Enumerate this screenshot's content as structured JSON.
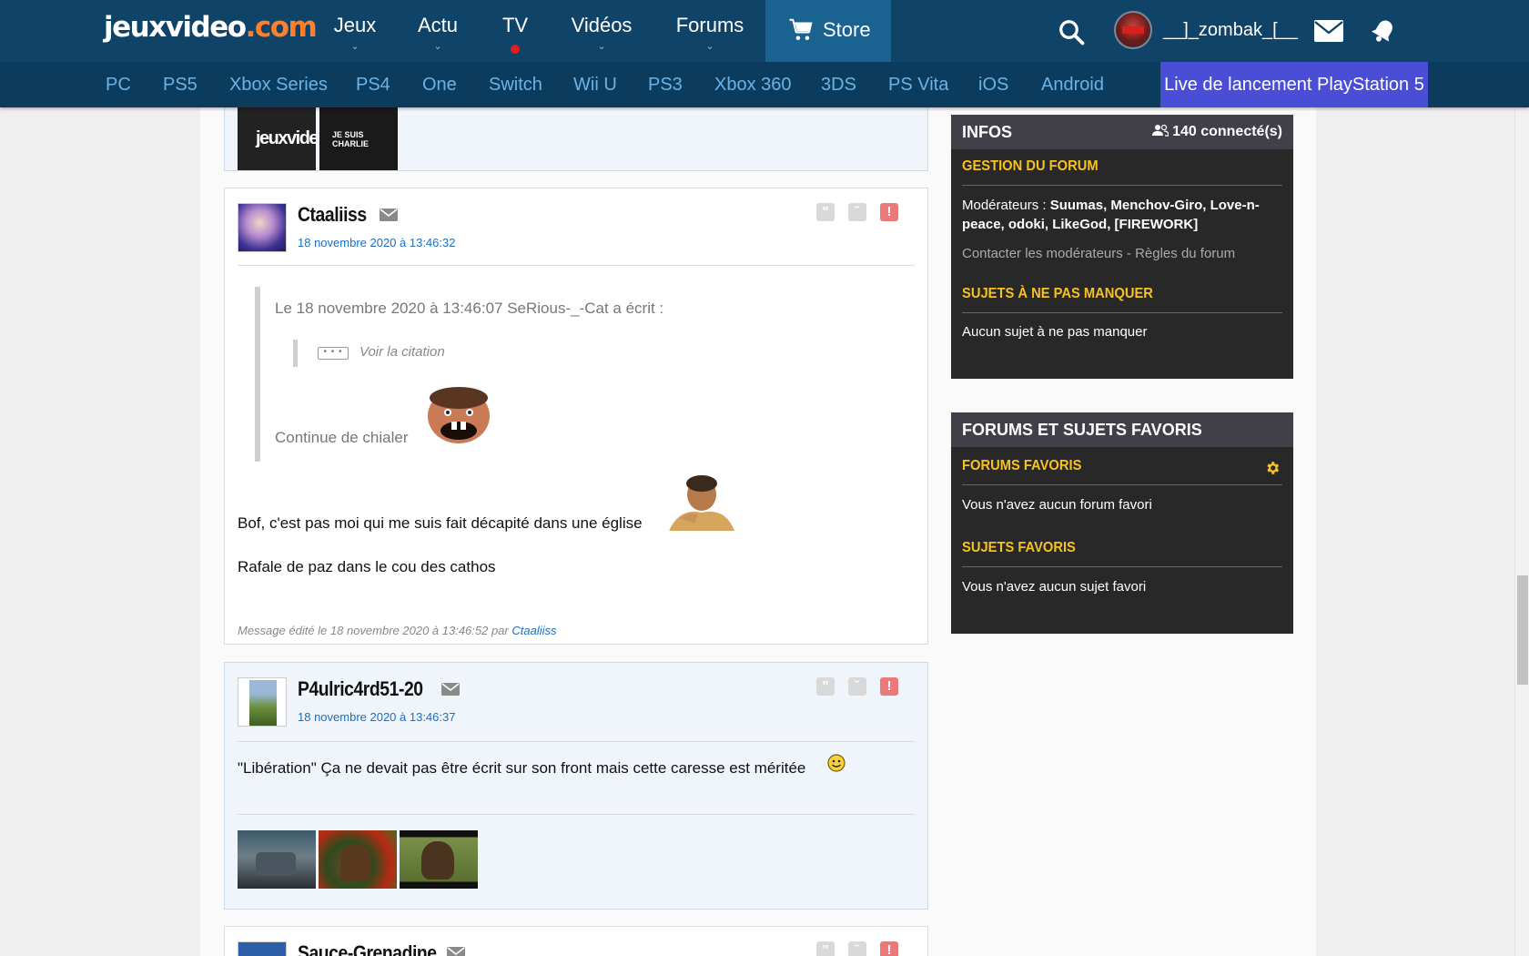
{
  "logo": {
    "main": "jeuxvideo",
    "dot": ".com"
  },
  "topnav": {
    "items": [
      {
        "label": "Jeux",
        "chev": "⌄"
      },
      {
        "label": "Actu",
        "chev": "⌄"
      },
      {
        "label": "TV"
      },
      {
        "label": "Vidéos",
        "chev": "⌄"
      },
      {
        "label": "Forums",
        "chev": "⌄"
      }
    ],
    "store": "Store",
    "username": "__]_zombak_[__"
  },
  "subnav": {
    "items": [
      "PC",
      "PS5",
      "Xbox Series",
      "PS4",
      "One",
      "Switch",
      "Wii U",
      "PS3",
      "Xbox 360",
      "3DS",
      "PS Vita",
      "iOS",
      "Android"
    ],
    "live": "Live de lancement PlayStation 5"
  },
  "posts": [
    {
      "author": "Ctaaliiss",
      "date": "18 novembre 2020 à 13:46:32",
      "quote_header": "Le 18 novembre 2020 à 13:46:07 SeRious-_-Cat a écrit :",
      "voir_citation": "Voir la citation",
      "dots": "• • •",
      "quote_text": "Continue de chialer",
      "body": [
        "Bof, c'est pas moi qui me suis fait décapité dans une église",
        "Rafale de paz dans le cou des cathos"
      ],
      "edited_prefix": "Message édité le 18 novembre 2020 à 13:46:52 par ",
      "edited_by": "Ctaaliiss"
    },
    {
      "author": "P4ulric4rd51-20",
      "date": "18 novembre 2020 à 13:46:37",
      "body": [
        "\"Libération\" Ça ne devait pas être écrit sur son front mais cette caresse est méritée"
      ]
    },
    {
      "author": "Sauce-Grenadine"
    }
  ],
  "prev_post_image_text": "jeuxvideo.c",
  "prev_post_badge": "JE SUIS CHARLIE",
  "sidebar": {
    "infos": {
      "title": "INFOS",
      "count": "140 connecté(s)",
      "gestion_title": "GESTION DU FORUM",
      "moderators_label": "Modérateurs : ",
      "moderators": "Suumas, Menchov-Giro, Love-n-peace, odoki, LikeGod, [FIREWORK]",
      "contact": "Contacter les modérateurs - Règles du forum",
      "sujets_title": "SUJETS À NE PAS MANQUER",
      "sujets_text": "Aucun sujet à ne pas manquer"
    },
    "favoris": {
      "title": "FORUMS ET SUJETS FAVORIS",
      "forums_title": "FORUMS FAVORIS",
      "forums_text": "Vous n'avez aucun forum favori",
      "sujets_title": "SUJETS FAVORIS",
      "sujets_text": "Vous n'avez aucun sujet favori"
    }
  },
  "colors": {
    "topbar": "#0f4468",
    "subbar": "#0c3c5d",
    "accent": "#f7c21d",
    "link": "#1b6fc1",
    "live": "#4a4ed6"
  },
  "icons": [
    "search-icon",
    "mail-icon",
    "bell-icon",
    "cart-icon",
    "quote-icon",
    "sad-icon",
    "alert-icon",
    "gear-icon",
    "users-icon"
  ]
}
